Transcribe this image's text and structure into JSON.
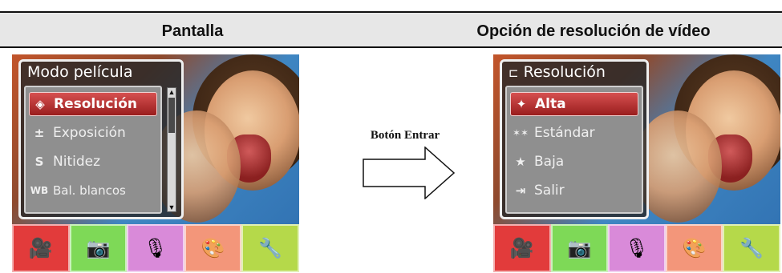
{
  "headers": {
    "left": "Pantalla",
    "right": "Opción de resolución de vídeo"
  },
  "middle": {
    "label": "Botón Entrar",
    "arrow_icon": "right-arrow-icon"
  },
  "left_screen": {
    "menu_title": "Modo película",
    "items": [
      {
        "label": "Resolución",
        "icon": "resolution-icon",
        "glyph": "◈",
        "selected": true
      },
      {
        "label": "Exposición",
        "icon": "exposure-icon",
        "glyph": "±",
        "selected": false
      },
      {
        "label": "Nitidez",
        "icon": "sharpness-icon",
        "glyph": "S",
        "selected": false
      },
      {
        "label": "Bal. blancos",
        "icon": "white-balance-icon",
        "glyph": "WB",
        "selected": false
      }
    ],
    "toolbar": [
      {
        "name": "movie-mode-tab",
        "icon": "camcorder-icon",
        "glyph": "🎥",
        "color": "#e23b3b"
      },
      {
        "name": "camera-mode-tab",
        "icon": "camera-icon",
        "glyph": "📷",
        "color": "#7ed957"
      },
      {
        "name": "voice-mode-tab",
        "icon": "microphone-icon",
        "glyph": "🎙",
        "color": "#d98ad9"
      },
      {
        "name": "effect-mode-tab",
        "icon": "palette-icon",
        "glyph": "🎨",
        "color": "#f3967a"
      },
      {
        "name": "setup-mode-tab",
        "icon": "tools-icon",
        "glyph": "🔧",
        "color": "#b5d94a"
      }
    ]
  },
  "right_screen": {
    "menu_title": "Resolución",
    "items": [
      {
        "label": "Alta",
        "icon": "high-quality-icon",
        "glyph": "✦",
        "selected": true
      },
      {
        "label": "Estándar",
        "icon": "standard-quality-icon",
        "glyph": "✶✶",
        "selected": false
      },
      {
        "label": "Baja",
        "icon": "low-quality-icon",
        "glyph": "★",
        "selected": false
      },
      {
        "label": "Salir",
        "icon": "exit-icon",
        "glyph": "⇥",
        "selected": false
      }
    ],
    "toolbar": [
      {
        "name": "movie-mode-tab",
        "icon": "camcorder-icon",
        "glyph": "🎥",
        "color": "#e23b3b"
      },
      {
        "name": "camera-mode-tab",
        "icon": "camera-icon",
        "glyph": "📷",
        "color": "#7ed957"
      },
      {
        "name": "voice-mode-tab",
        "icon": "microphone-icon",
        "glyph": "🎙",
        "color": "#d98ad9"
      },
      {
        "name": "effect-mode-tab",
        "icon": "palette-icon",
        "glyph": "🎨",
        "color": "#f3967a"
      },
      {
        "name": "setup-mode-tab",
        "icon": "tools-icon",
        "glyph": "🔧",
        "color": "#b5d94a"
      }
    ]
  }
}
